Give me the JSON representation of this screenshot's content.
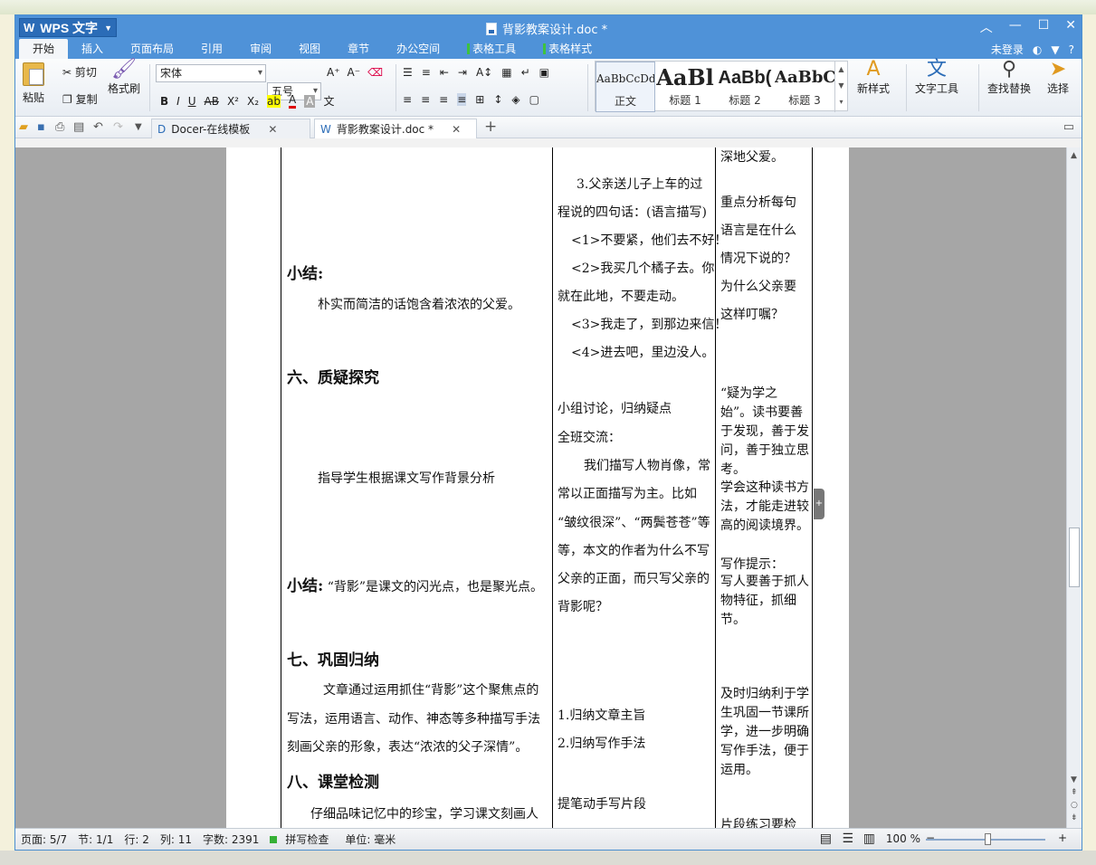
{
  "app": {
    "logo_label": "WPS 文字",
    "window_title": "背影教案设计.doc *",
    "window_buttons": [
      "︿",
      "—",
      "☐",
      "✕"
    ]
  },
  "menu": {
    "tabs": [
      "开始",
      "插入",
      "页面布局",
      "引用",
      "审阅",
      "视图",
      "章节",
      "办公空间"
    ],
    "context_tabs": [
      "表格工具",
      "表格样式"
    ],
    "login": "未登录",
    "help": "?"
  },
  "ribbon": {
    "paste": "粘贴",
    "cut": "剪切",
    "copy": "复制",
    "format_painter": "格式刷",
    "font_name": "宋体",
    "font_size": "五号",
    "styles": [
      {
        "preview": "AaBbCcDd",
        "label": "正文"
      },
      {
        "preview": "AaBl",
        "label": "标题 1"
      },
      {
        "preview": "AaBb(",
        "label": "标题 2"
      },
      {
        "preview": "AaBbC",
        "label": "标题 3"
      }
    ],
    "new_style": "新样式",
    "text_tools": "文字工具",
    "find_replace": "查找替换",
    "select": "选择"
  },
  "tabs": {
    "docer": "Docer-在线模板",
    "doc": "背影教案设计.doc *"
  },
  "document": {
    "col1": {
      "summary1_title": "小结:",
      "summary1_text": "朴实而简洁的话饱含着浓浓的父爱。",
      "sec6_title": "六、质疑探究",
      "sec6_text": "指导学生根据课文写作背景分析",
      "summary2_title": "小结:",
      "summary2_text": "“背影”是课文的闪光点，也是聚光点。",
      "sec7_title": "七、巩固归纳",
      "sec7_l1": "文章通过运用抓住“背影”这个聚焦点的",
      "sec7_l2": "写法，运用语言、动作、神态等多种描写手法",
      "sec7_l3": "刻画父亲的形象，表达“浓浓的父子深情”。",
      "sec8_title": "八、课堂检测",
      "sec8_l1": "仔细品味记忆中的珍宝，学习课文刻画人"
    },
    "col2": {
      "q3_l1": "3.父亲送儿子上车的过",
      "q3_l2": "程说的四句话：(语言描写)",
      "s1": "<1>不要紧，他们去不好！",
      "s2a": "<2>我买几个橘子去。你",
      "s2b": "就在此地，不要走动。",
      "s3": "<3>我走了，到那边来信！",
      "s4": "<4>进去吧，里边没人。",
      "disc1": "小组讨论，归纳疑点",
      "disc2": "全班交流：",
      "disc3": "我们描写人物肖像，常",
      "disc4": "常以正面描写为主。比如",
      "disc5": "“皱纹很深”、“两鬓苍苍”等",
      "disc6": "等，本文的作者为什么不写",
      "disc7": "父亲的正面，而只写父亲的",
      "disc8": "背影呢？",
      "sum1": "1.归纳文章主旨",
      "sum2": "2.归纳写作手法",
      "pen": "提笔动手写片段"
    },
    "col3": {
      "a0": "深地父爱。",
      "a1": "重点分析每句",
      "a2": "语言是在什么",
      "a3": "情况下说的？",
      "a4": "为什么父亲要",
      "a5": "这样叮嘱？",
      "b": "“疑为学之始”。读书要善于发现，善于发问，善于独立思考。",
      "c": "学会这种读书方法，才能走进较高的阅读境界。",
      "d": "写作提示：",
      "e": "写人要善于抓人物特征，抓细节。",
      "f": "及时归纳利于学生巩固一节课所学，进一步明确写作手法，便于运用。",
      "g": "片段练习要检"
    }
  },
  "status": {
    "page": "页面: 5/7",
    "section": "节: 1/1",
    "row": "行: 2",
    "col": "列: 11",
    "words": "字数: 2391",
    "spell": "拼写检查",
    "unit": "单位: 毫米",
    "zoom": "100 %"
  }
}
